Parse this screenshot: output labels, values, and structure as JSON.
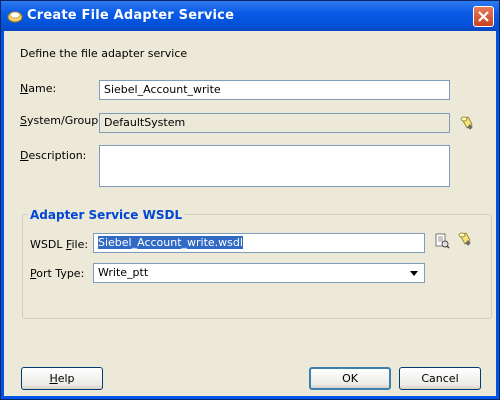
{
  "window": {
    "title": "Create File Adapter Service"
  },
  "intro": "Define the file adapter service",
  "form": {
    "name_label_mn": "N",
    "name_label_rest": "ame:",
    "name_value": "Siebel_Account_write",
    "system_label_mn": "S",
    "system_label_rest": "ystem/Group:",
    "system_value": "DefaultSystem",
    "description_label_mn": "D",
    "description_label_rest": "escription:",
    "description_value": ""
  },
  "wsdl_group": {
    "title": "Adapter Service WSDL",
    "wsdl_label_pre": "WSDL ",
    "wsdl_label_mn": "F",
    "wsdl_label_rest": "ile:",
    "wsdl_value": "Siebel_Account_write.wsdl",
    "port_label_mn": "P",
    "port_label_rest": "ort Type:",
    "port_value": "Write_ptt"
  },
  "buttons": {
    "help_mn": "H",
    "help_rest": "elp",
    "ok": "OK",
    "cancel": "Cancel"
  },
  "icons": {
    "title": "oracle-app-icon",
    "browse_system": "flashlight-icon",
    "browse_wsdl": "wsdl-browse-icon",
    "find_wsdl": "flashlight-icon"
  }
}
